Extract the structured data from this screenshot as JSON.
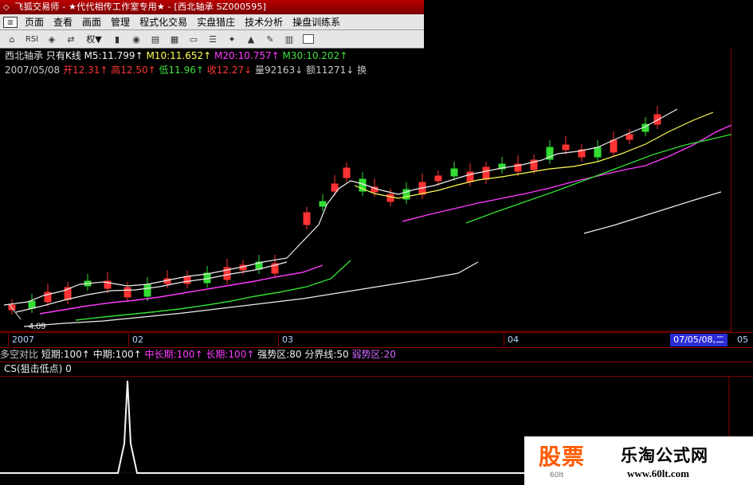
{
  "window": {
    "title": "飞狐交易师 - ★代代相传工作室专用★ - [西北轴承 SZ000595]"
  },
  "menus": [
    "页面",
    "查看",
    "画面",
    "管理",
    "程式化交易",
    "实盘猎庄",
    "技术分析",
    "操盘训练系"
  ],
  "toolbar": {
    "adjust_label": "权"
  },
  "chart": {
    "stock_name": "西北轴承",
    "mode": "只有K线",
    "ma5": "M5:11.799↑",
    "ma10": "M10:11.652↑",
    "ma20": "M20:10.757↑",
    "ma30": "M30:10.202↑",
    "date": "2007/05/08",
    "open": "开12.31↑",
    "high": "高12.50↑",
    "low": "低11.96↑",
    "close": "收12.27↓",
    "volume": "量92163↓",
    "amount": "额11271↓",
    "truncated": "换",
    "low_label": "4.09",
    "xaxis": {
      "t1": "2007",
      "t2": "02",
      "t3": "03",
      "t4": "04",
      "selected_date": "07/05/08,二",
      "right_label": "05"
    }
  },
  "indicator": {
    "name": "多空对比",
    "short": "短期:100↑",
    "mid": "中期:100↑",
    "midlong": "中长期:100↑",
    "long": "长期:100↑",
    "strong": "强势区:80",
    "boundary": "分界线:50",
    "weak": "弱势区:20"
  },
  "cs": {
    "label": "CS(狙击低点) 0"
  },
  "watermark": {
    "left_big": "股票",
    "left_small": "60lt",
    "right_big": "乐淘公式网",
    "right_url": "www.60lt.com"
  },
  "colors": {
    "background": "#000000",
    "title_red": "#9a0000",
    "border_red": "#8a0000",
    "up": "#ff3333",
    "down": "#33dd33",
    "ma5": "#f0f0f0",
    "ma10": "#ffff55",
    "ma20": "#ff3aff",
    "ma30": "#33dd33",
    "selected_blue": "#2c2cd6"
  }
}
